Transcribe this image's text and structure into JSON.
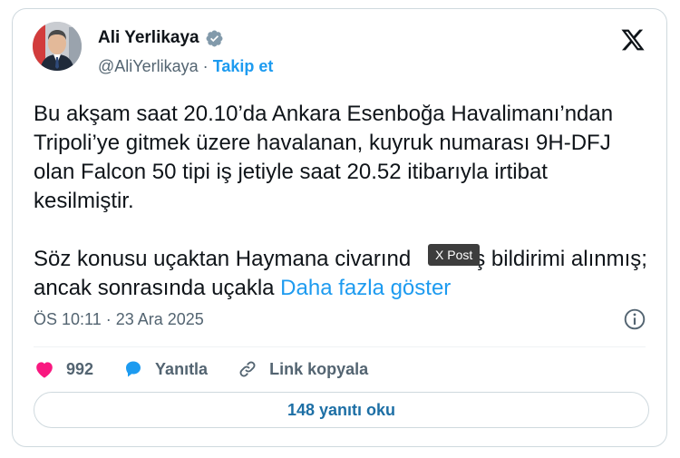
{
  "author": {
    "name": "Ali Yerlikaya",
    "handle": "@AliYerlikaya",
    "separator": "·",
    "follow_label": "Takip et"
  },
  "tweet": {
    "paragraph1": "Bu akşam saat 20.10’da Ankara Esenboğa Havalimanı’ndan Tripoli’ye gitmek üzere havalanan, kuyruk numarası 9H-DFJ olan Falcon 50 tipi iş jetiyle saat 20.52 itibarıyla irtibat kesilmiştir.",
    "paragraph2": "Söz konusu uçaktan Haymana civarınd",
    "paragraph2_after_tooltip": "l iniş bildirimi alınmış; ancak sonrasında uçakla ",
    "show_more": "Daha fazla göster"
  },
  "tooltip": "X Post",
  "timestamp": "ÖS 10:11 · 23 Ara 2025",
  "actions": {
    "like_count": "992",
    "reply_label": "Yanıtla",
    "copy_link_label": "Link kopyala"
  },
  "read_replies": "148 yanıtı oku",
  "colors": {
    "accent": "#1d9bf0",
    "like": "#f91880",
    "verified": "#829aab",
    "border": "#cfd9de"
  }
}
